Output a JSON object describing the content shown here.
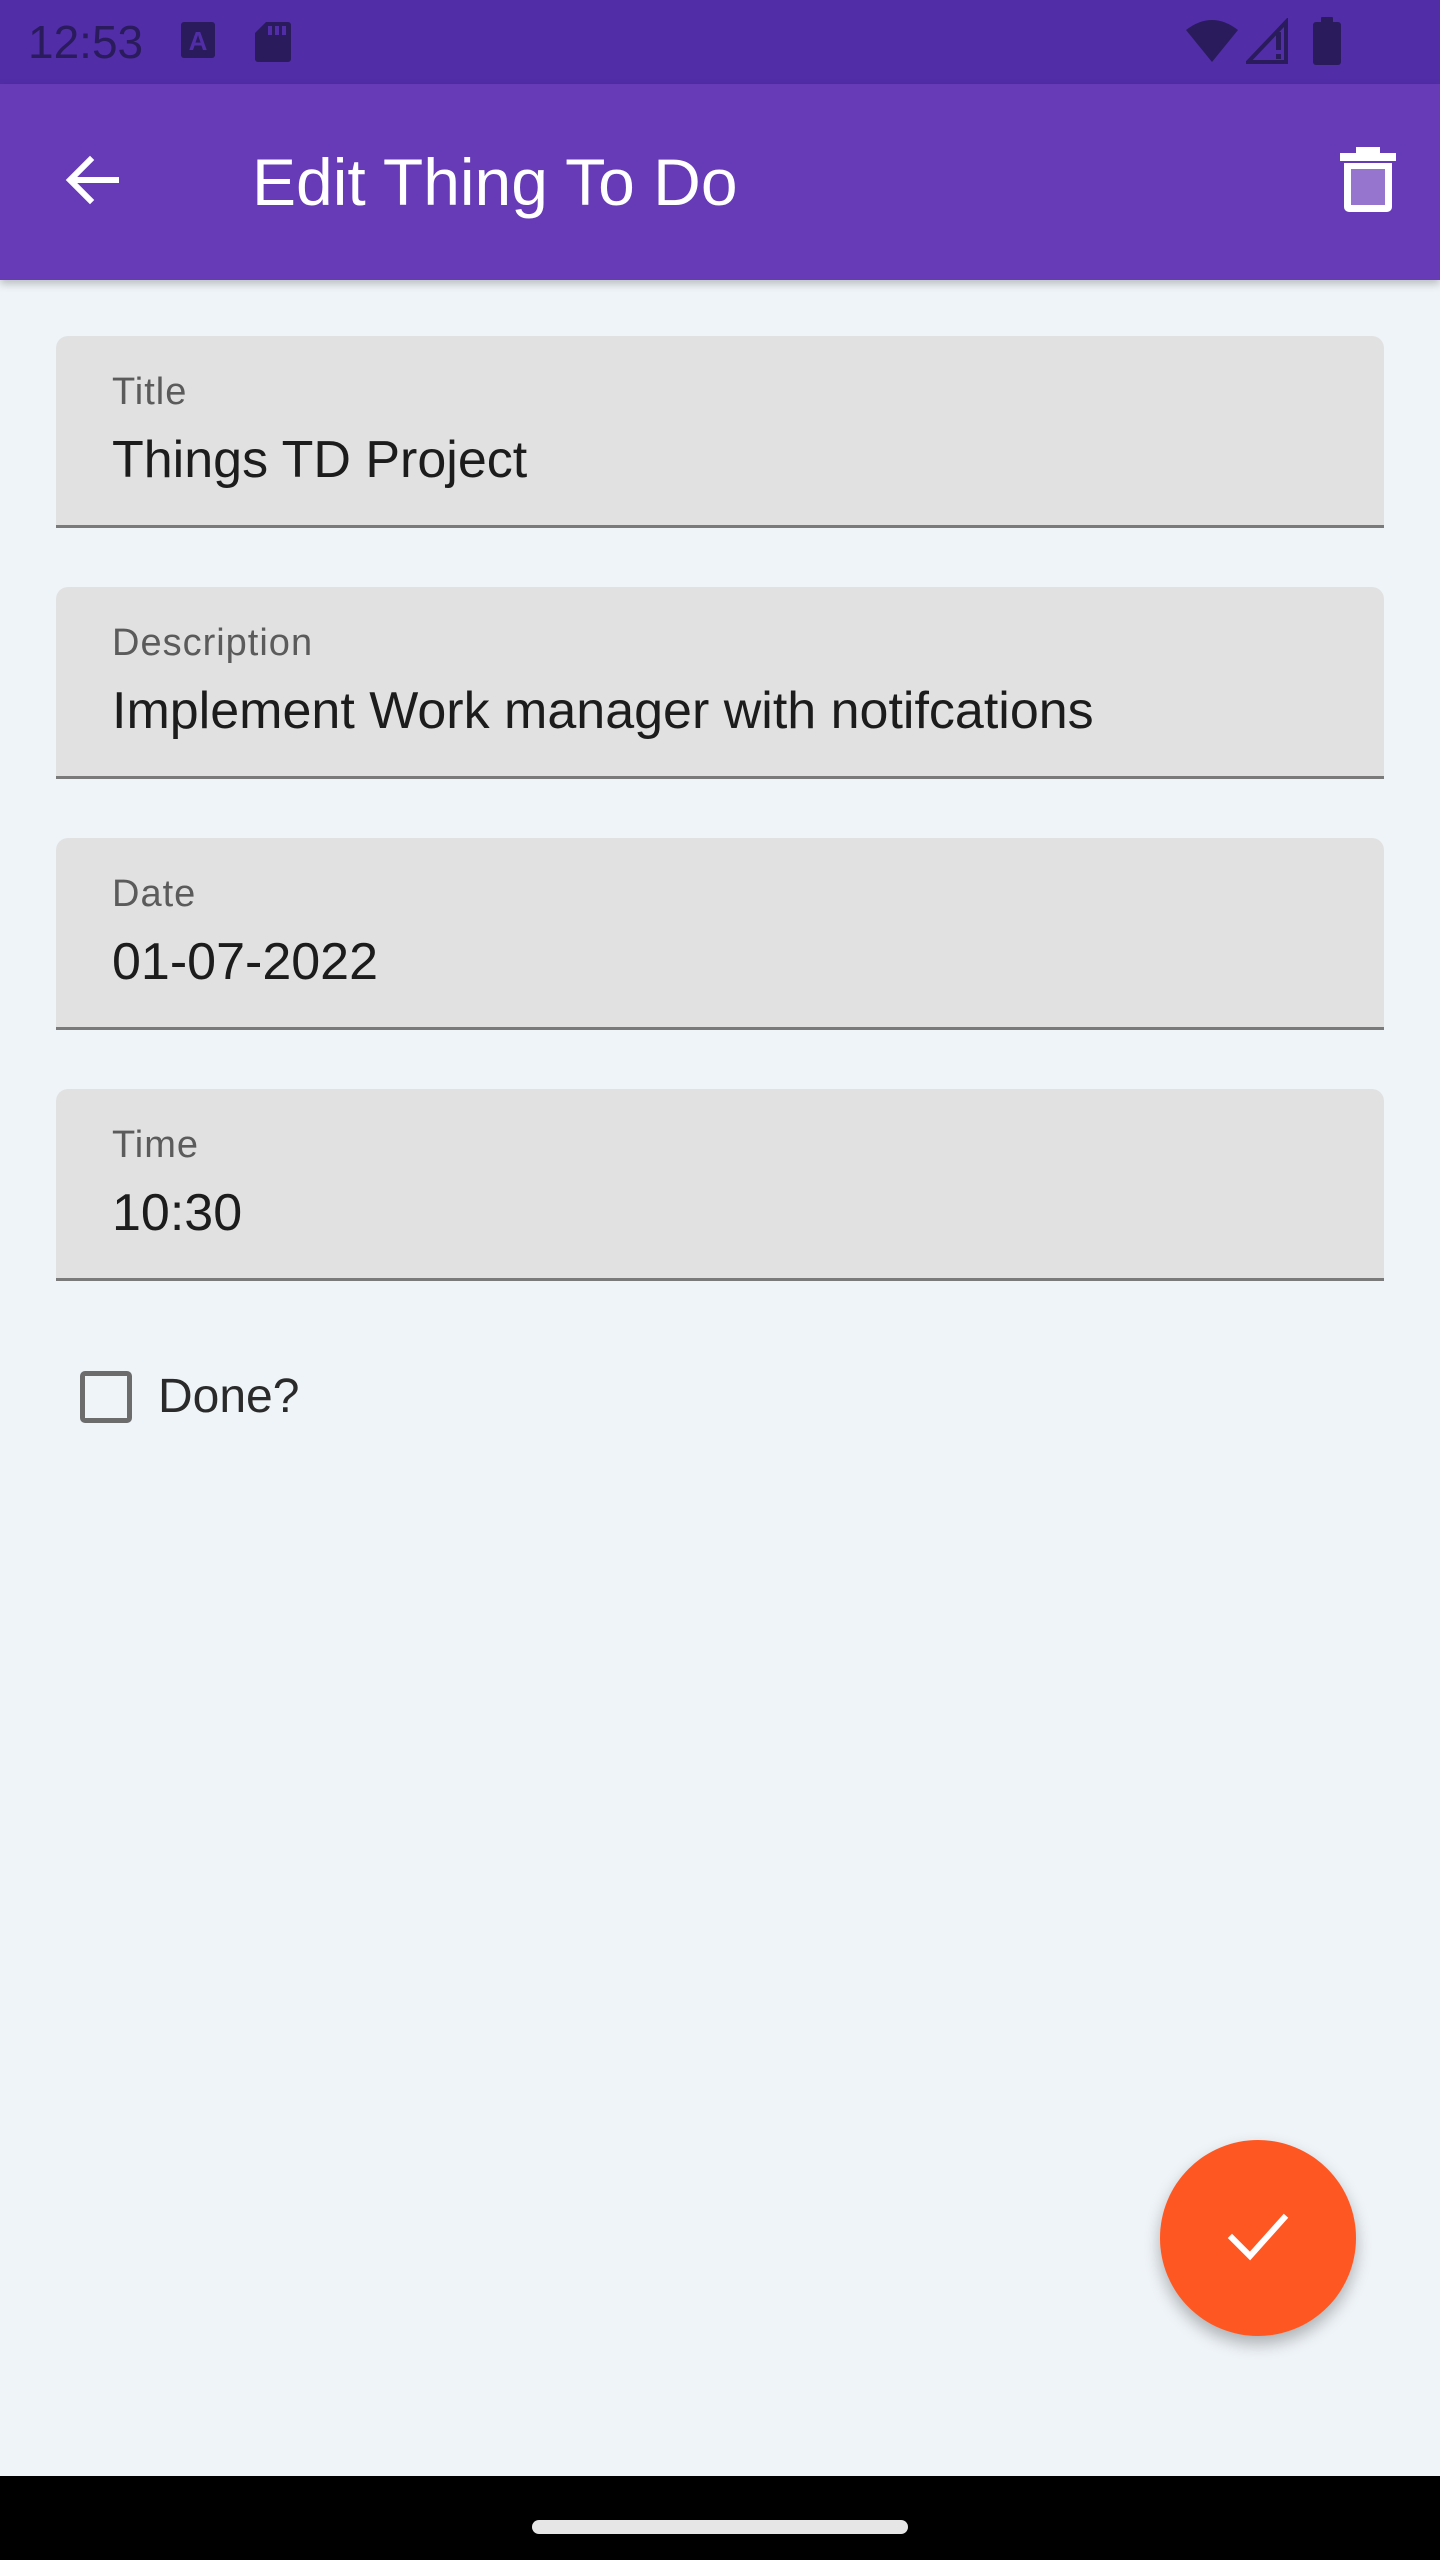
{
  "status_bar": {
    "time": "12:53",
    "icons": [
      "keyboard-a-icon",
      "sd-card-icon",
      "wifi-icon",
      "signal-icon",
      "battery-icon"
    ]
  },
  "app_bar": {
    "title": "Edit Thing To Do",
    "back_icon": "arrow-back-icon",
    "delete_icon": "delete-icon"
  },
  "form": {
    "title": {
      "label": "Title",
      "value": "Things TD Project"
    },
    "description": {
      "label": "Description",
      "value": "Implement Work manager with notifcations"
    },
    "date": {
      "label": "Date",
      "value": "01-07-2022"
    },
    "time": {
      "label": "Time",
      "value": "10:30"
    },
    "done": {
      "label": "Done?",
      "checked": false
    }
  },
  "fab": {
    "icon": "check-icon"
  },
  "colors": {
    "status_bar": "#512da8",
    "app_bar": "#673ab7",
    "fab": "#ff5722",
    "background": "#eff4f8",
    "field_fill": "#e1e1e1"
  }
}
